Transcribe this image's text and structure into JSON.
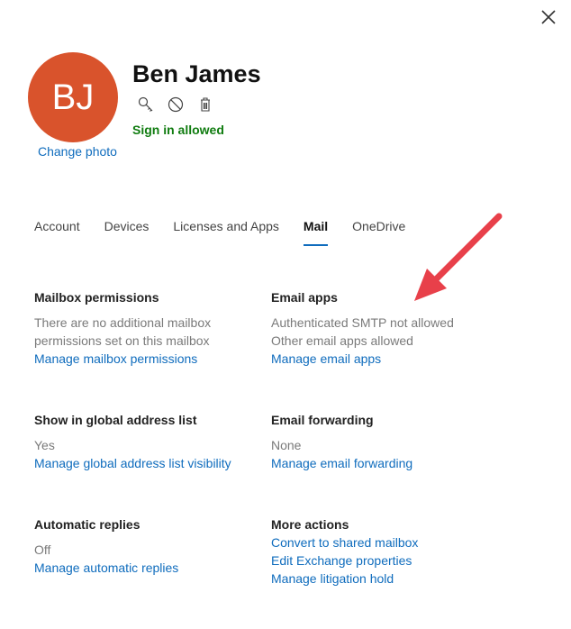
{
  "header": {
    "initials": "BJ",
    "change_photo": "Change photo",
    "name": "Ben James",
    "status": "Sign in allowed",
    "icons": [
      "key-icon",
      "block-icon",
      "trash-icon"
    ]
  },
  "tabs": [
    {
      "label": "Account",
      "active": false
    },
    {
      "label": "Devices",
      "active": false
    },
    {
      "label": "Licenses and Apps",
      "active": false
    },
    {
      "label": "Mail",
      "active": true
    },
    {
      "label": "OneDrive",
      "active": false
    }
  ],
  "sections": {
    "mailbox_permissions": {
      "title": "Mailbox permissions",
      "values": [
        "There are no additional mailbox permissions set on this mailbox"
      ],
      "links": [
        "Manage mailbox permissions"
      ]
    },
    "email_apps": {
      "title": "Email apps",
      "values": [
        "Authenticated SMTP not allowed",
        "Other email apps allowed"
      ],
      "links": [
        "Manage email apps"
      ]
    },
    "global_address_list": {
      "title": "Show in global address list",
      "values": [
        "Yes"
      ],
      "links": [
        "Manage global address list visibility"
      ]
    },
    "email_forwarding": {
      "title": "Email forwarding",
      "values": [
        "None"
      ],
      "links": [
        "Manage email forwarding"
      ]
    },
    "automatic_replies": {
      "title": "Automatic replies",
      "values": [
        "Off"
      ],
      "links": [
        "Manage automatic replies"
      ]
    },
    "more_actions": {
      "title": "More actions",
      "values": [],
      "links": [
        "Convert to shared mailbox",
        "Edit Exchange properties",
        "Manage litigation hold"
      ]
    }
  },
  "colors": {
    "avatar": "#d9532c",
    "link": "#0f6cbd",
    "status": "#107c10",
    "annotation_arrow": "#e8404a"
  }
}
